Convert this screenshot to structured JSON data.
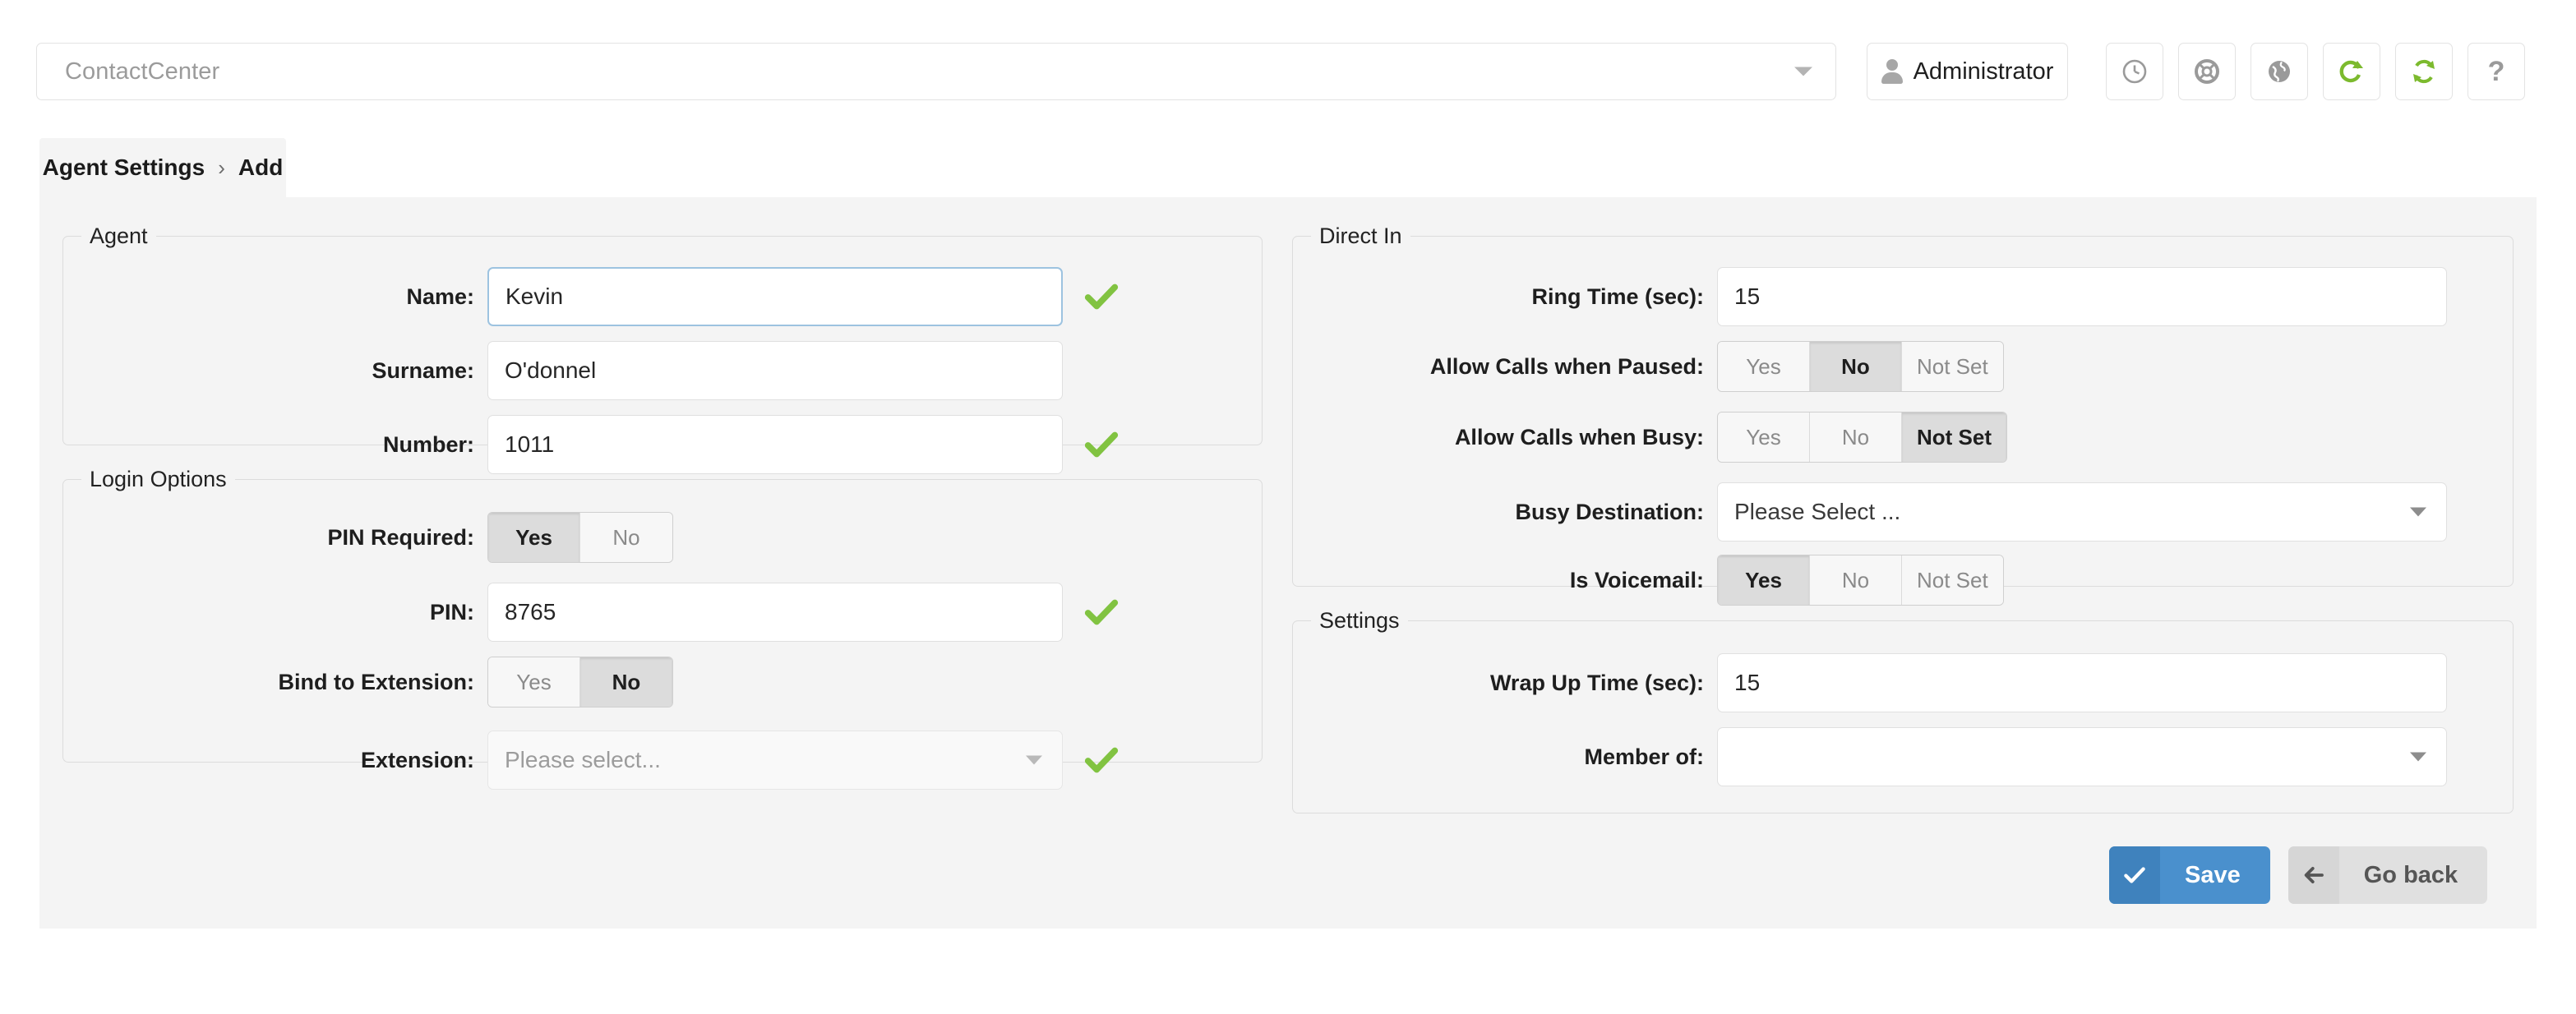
{
  "topbar": {
    "context_select": {
      "value": "ContactCenter",
      "caret": "chevron-down-icon"
    },
    "admin_button": {
      "label": "Administrator",
      "icon": "user-icon"
    },
    "icon_buttons": [
      {
        "name": "clock-icon",
        "title": "Clock"
      },
      {
        "name": "life-ring-icon",
        "title": "Support"
      },
      {
        "name": "globe-icon",
        "title": "Language"
      },
      {
        "name": "refresh-icon",
        "title": "Reload"
      },
      {
        "name": "sync-icon",
        "title": "Sync"
      },
      {
        "name": "help-icon",
        "title": "Help",
        "glyph": "?"
      }
    ]
  },
  "breadcrumb": {
    "root": "Agent Settings",
    "separator": "›",
    "current": "Add"
  },
  "sections": {
    "agent": {
      "legend": "Agent",
      "fields": [
        {
          "label": "Name:",
          "value": "Kevin",
          "focused": true,
          "valid": true
        },
        {
          "label": "Surname:",
          "value": "O'donnel",
          "focused": false,
          "valid": false
        },
        {
          "label": "Number:",
          "value": "1011",
          "focused": false,
          "valid": true
        }
      ]
    },
    "login_options": {
      "legend": "Login Options",
      "pin_required": {
        "label": "PIN Required:",
        "options": [
          "Yes",
          "No"
        ],
        "selected": "Yes"
      },
      "pin": {
        "label": "PIN:",
        "value": "8765",
        "valid": true
      },
      "bind_to_extension": {
        "label": "Bind to Extension:",
        "options": [
          "Yes",
          "No"
        ],
        "selected": "No"
      },
      "extension": {
        "label": "Extension:",
        "placeholder": "Please select...",
        "value": "",
        "disabled": true,
        "valid": true
      }
    },
    "direct_in": {
      "legend": "Direct In",
      "ring_time": {
        "label": "Ring Time (sec):",
        "value": "15"
      },
      "allow_calls_paused": {
        "label": "Allow Calls when Paused:",
        "options": [
          "Yes",
          "No",
          "Not Set"
        ],
        "selected": "No"
      },
      "allow_calls_busy": {
        "label": "Allow Calls when Busy:",
        "options": [
          "Yes",
          "No",
          "Not Set"
        ],
        "selected": "Not Set"
      },
      "busy_destination": {
        "label": "Busy Destination:",
        "value": "Please Select ..."
      },
      "is_voicemail": {
        "label": "Is Voicemail:",
        "options": [
          "Yes",
          "No",
          "Not Set"
        ],
        "selected": "Yes"
      }
    },
    "settings": {
      "legend": "Settings",
      "wrap_up_time": {
        "label": "Wrap Up Time (sec):",
        "value": "15"
      },
      "member_of": {
        "label": "Member of:",
        "value": ""
      }
    }
  },
  "actions": {
    "save": {
      "label": "Save",
      "icon": "check-icon",
      "color": "#4a90cd"
    },
    "go_back": {
      "label": "Go back",
      "icon": "arrow-left-icon",
      "color": "#e0e0e0"
    }
  },
  "colors": {
    "panel_bg": "#f4f4f4",
    "valid_green": "#81c341",
    "accent_blue": "#4a90cd",
    "focus_blue": "#9dc3e0"
  }
}
